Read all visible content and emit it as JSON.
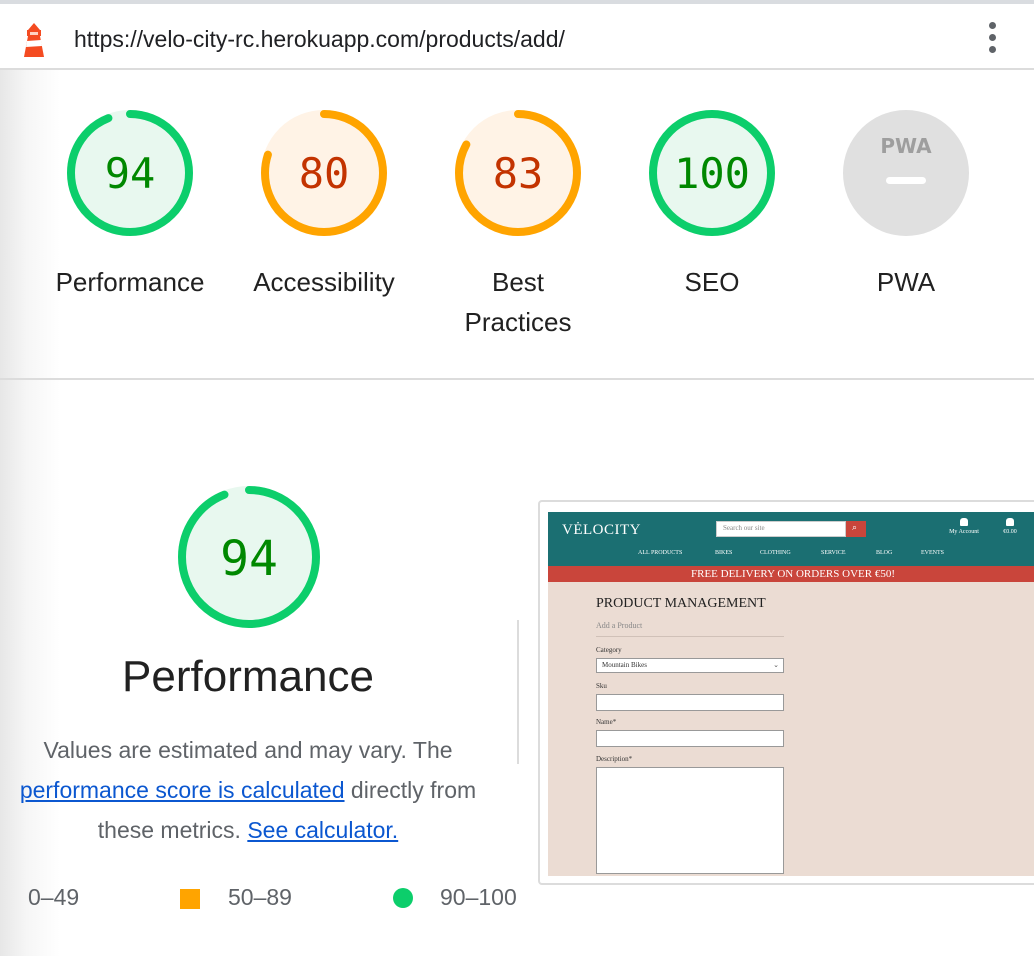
{
  "browser": {
    "url": "https://velo-city-rc.herokuapp.com/products/add/",
    "logo_icon": "lighthouse-icon",
    "menu_icon": "more-vertical-icon"
  },
  "colors": {
    "pass": "#0cce6b",
    "pass_text": "#008800",
    "pass_bg": "#e8f8ef",
    "average": "#ffa400",
    "average_text": "#c33300",
    "average_bg": "#fff3e6",
    "fail": "#ff3333",
    "na": "#e0e0e0",
    "na_text": "#9e9e9e"
  },
  "categories": [
    {
      "label": "Performance",
      "score": 94,
      "rating": "pass"
    },
    {
      "label": "Accessibility",
      "score": 80,
      "rating": "average"
    },
    {
      "label": "Best Practices",
      "score": 83,
      "rating": "average"
    },
    {
      "label": "SEO",
      "score": 100,
      "rating": "pass"
    },
    {
      "label": "PWA",
      "score": null,
      "rating": "na",
      "badge": "PWA",
      "icon": "pwa-icon"
    }
  ],
  "performance": {
    "score": "94",
    "score_fraction": 0.94,
    "title": "Performance",
    "desc_part1": "Values are estimated and may vary. The",
    "desc_link1": "performance score is calculated",
    "desc_part2": "directly from",
    "desc_part3": "these metrics.",
    "desc_link2": "See calculator."
  },
  "legend": [
    {
      "range": "0–49",
      "icon": "fail-triangle-icon"
    },
    {
      "range": "50–89",
      "icon": "average-square-icon"
    },
    {
      "range": "90–100",
      "icon": "pass-circle-icon"
    }
  ],
  "screenshot": {
    "brand": "VĖLOCITY",
    "search_placeholder": "Search our site",
    "account_label": "My Account",
    "cart_total": "€0.00",
    "nav": [
      "ALL PRODUCTS",
      "BIKES",
      "CLOTHING",
      "SERVICE",
      "BLOG",
      "EVENTS"
    ],
    "banner": "FREE DELIVERY ON ORDERS OVER €50!",
    "heading": "PRODUCT MANAGEMENT",
    "subheading": "Add a Product",
    "field_category": "Category",
    "field_category_value": "Mountain Bikes",
    "field_sku": "Sku",
    "field_name": "Name*",
    "field_description": "Description*"
  }
}
